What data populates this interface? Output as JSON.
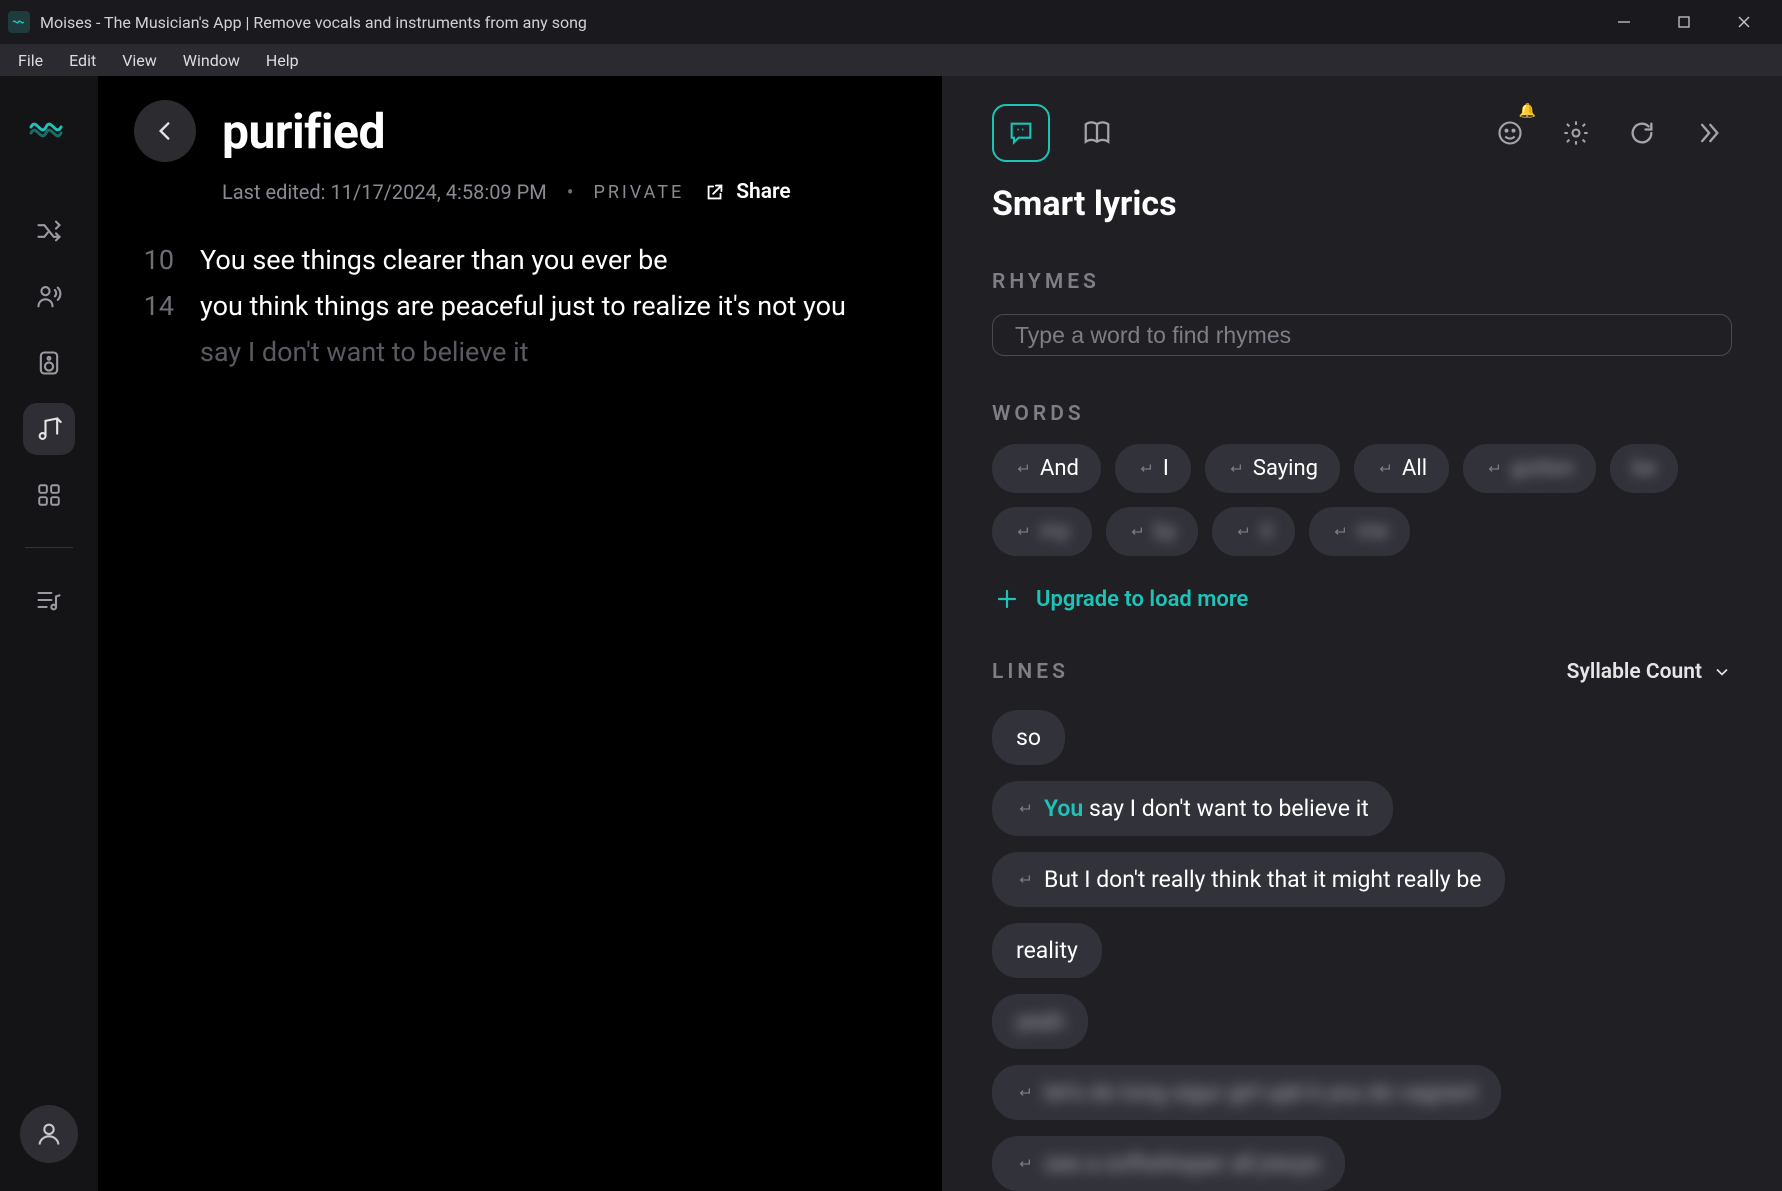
{
  "window": {
    "title": "Moises - The Musician's App | Remove vocals and instruments from any song"
  },
  "menu": [
    "File",
    "Edit",
    "View",
    "Window",
    "Help"
  ],
  "editor": {
    "title": "purified",
    "last_edited_prefix": "Last edited: ",
    "last_edited": "11/17/2024, 4:58:09 PM",
    "visibility": "PRIVATE",
    "share_label": "Share",
    "lines": [
      {
        "syllables": "10",
        "text": "You see things clearer than you ever be",
        "ghost": false
      },
      {
        "syllables": "14",
        "text": "you think things are peaceful just to realize it's not you",
        "ghost": false
      },
      {
        "syllables": "",
        "text": "say I don't want to believe it",
        "ghost": true
      }
    ]
  },
  "smart": {
    "title": "Smart lyrics",
    "rhymes_label": "RHYMES",
    "rhymes_placeholder": "Type a word to find rhymes",
    "words_label": "WORDS",
    "words": [
      {
        "text": "And",
        "enter": true,
        "blur": false
      },
      {
        "text": "I",
        "enter": true,
        "blur": false
      },
      {
        "text": "Saying",
        "enter": true,
        "blur": false
      },
      {
        "text": "All",
        "enter": true,
        "blur": false
      },
      {
        "text": "gotten",
        "enter": true,
        "blur": true
      },
      {
        "text": "be",
        "enter": false,
        "blur": true
      },
      {
        "text": "my",
        "enter": true,
        "blur": true
      },
      {
        "text": "by",
        "enter": true,
        "blur": true
      },
      {
        "text": "it",
        "enter": true,
        "blur": true
      },
      {
        "text": "me",
        "enter": true,
        "blur": true
      }
    ],
    "upgrade_label": "Upgrade to load more",
    "lines_label": "LINES",
    "syllable_dd": "Syllable Count",
    "lines": [
      {
        "prefix": "",
        "text": "so",
        "enter": false,
        "blur": false
      },
      {
        "prefix": "You",
        "text": " say I don't want to believe it",
        "enter": true,
        "blur": false
      },
      {
        "prefix": "",
        "text": "But I don't really think that it might really be",
        "enter": true,
        "blur": false
      },
      {
        "prefix": "",
        "text": "reality",
        "enter": false,
        "blur": false
      },
      {
        "prefix": "",
        "text": "yeah",
        "enter": false,
        "blur": true
      },
      {
        "prefix": "",
        "text": "let's do long sigur girl upk k you do vagrant",
        "enter": true,
        "blur": true
      },
      {
        "prefix": "",
        "text": "see a softwhisper all jreuys",
        "enter": true,
        "blur": true
      }
    ]
  }
}
